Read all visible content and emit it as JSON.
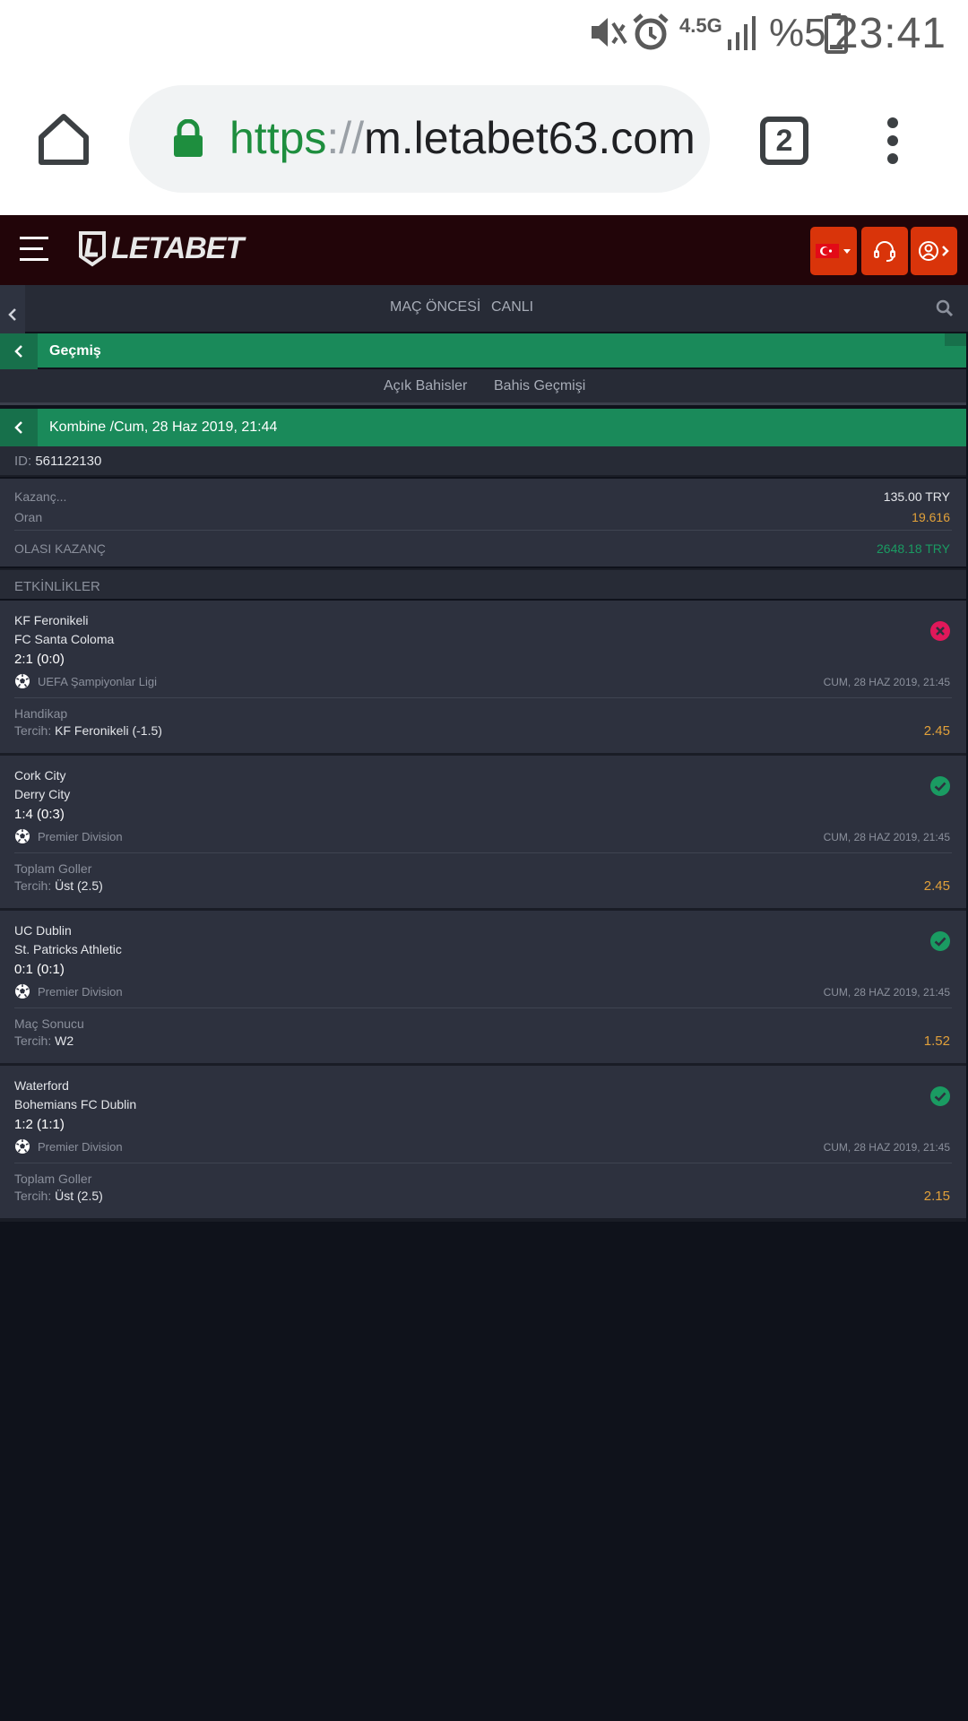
{
  "status_bar": {
    "network": "4.5G",
    "battery": "%5",
    "time": "23:41"
  },
  "browser": {
    "url_scheme": "https",
    "url_sep": "://",
    "url_host": "m.letabet63.com",
    "tab_count": "2"
  },
  "site": {
    "logo_text": "LETABET"
  },
  "nav": {
    "prematch": "MAÇ ÖNCESİ",
    "live": "CANLI"
  },
  "history": {
    "title": "Geçmiş",
    "tab_open": "Açık Bahisler",
    "tab_history": "Bahis Geçmişi"
  },
  "coupon": {
    "title": "Kombine /Cum, 28 Haz 2019, 21:44",
    "id_label": "ID:",
    "id_value": "561122130",
    "stake_label": "Kazanç...",
    "stake_value": "135.00 TRY",
    "odds_label": "Oran",
    "odds_value": "19.616",
    "potential_label": "OLASI KAZANÇ",
    "potential_value": "2648.18 TRY",
    "events_label": "ETKİNLİKLER"
  },
  "pick_label": "Tercih:",
  "events": [
    {
      "team1": "KF Feronikeli",
      "team2": "FC Santa Coloma",
      "score": "2:1 (0:0)",
      "league": "UEFA Şampiyonlar Ligi",
      "date": "CUM, 28 HAZ 2019, 21:45",
      "market": "Handikap",
      "pick": "KF Feronikeli (-1.5)",
      "odd": "2.45",
      "status": "lost"
    },
    {
      "team1": "Cork City",
      "team2": "Derry City",
      "score": "1:4 (0:3)",
      "league": "Premier Division",
      "date": "CUM, 28 HAZ 2019, 21:45",
      "market": "Toplam Goller",
      "pick": "Üst (2.5)",
      "odd": "2.45",
      "status": "won"
    },
    {
      "team1": "UC Dublin",
      "team2": "St. Patricks Athletic",
      "score": "0:1 (0:1)",
      "league": "Premier Division",
      "date": "CUM, 28 HAZ 2019, 21:45",
      "market": "Maç Sonucu",
      "pick": "W2",
      "odd": "1.52",
      "status": "won"
    },
    {
      "team1": "Waterford",
      "team2": "Bohemians FC Dublin",
      "score": "1:2 (1:1)",
      "league": "Premier Division",
      "date": "CUM, 28 HAZ 2019, 21:45",
      "market": "Toplam Goller",
      "pick": "Üst (2.5)",
      "odd": "2.15",
      "status": "won"
    }
  ],
  "colors": {
    "accent_green": "#1a8a5a",
    "header_red": "#d9340a",
    "odds_orange": "#e2a13a",
    "won_green": "#1a9b62",
    "lost_pink": "#e0185a"
  },
  "icons": [
    "mute-icon",
    "alarm-icon",
    "signal-icon",
    "battery-icon",
    "home-icon",
    "lock-icon",
    "more-vert-icon",
    "hamburger-icon",
    "turkey-flag-icon",
    "headset-icon",
    "user-icon",
    "search-icon",
    "chevron-left-icon",
    "soccer-ball-icon",
    "check-circle-icon",
    "x-circle-icon"
  ]
}
